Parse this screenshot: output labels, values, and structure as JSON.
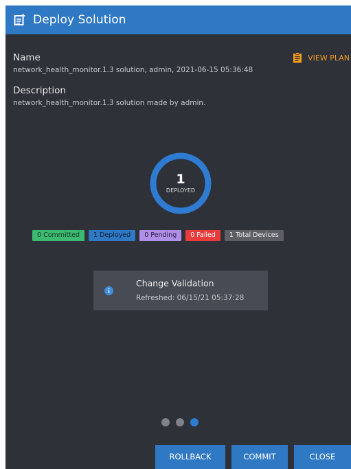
{
  "header": {
    "title": "Deploy Solution",
    "icon": "notes-add-icon"
  },
  "details": {
    "name_label": "Name",
    "name_value": "network_health_monitor.1.3 solution, admin, 2021-06-15 05:36:48",
    "description_label": "Description",
    "description_value": "network_health_monitor.1.3 solution made by admin.",
    "view_plan_label": "VIEW PLAN"
  },
  "summary": {
    "count": "1",
    "count_label": "DEPLOYED",
    "ring_color": "#2f7bd1"
  },
  "badges": [
    {
      "label": "0 Committed",
      "bg": "#3dba72",
      "fg": "#10331f"
    },
    {
      "label": "1 Deployed",
      "bg": "#2f78c4",
      "fg": "#0c1f36"
    },
    {
      "label": "0 Pending",
      "bg": "#b08fe6",
      "fg": "#2a1b47"
    },
    {
      "label": "0 Failed",
      "bg": "#ea3b3b",
      "fg": "#ffffff"
    },
    {
      "label": "1 Total Devices",
      "bg": "#5d5f64",
      "fg": "#f0f0f0"
    }
  ],
  "validation": {
    "title": "Change Validation",
    "refreshed": "Refreshed: 06/15/21 05:37:28"
  },
  "pager": {
    "total_steps": 3,
    "current_step": 3
  },
  "actions": {
    "rollback_label": "ROLLBACK",
    "commit_label": "COMMIT",
    "close_label": "CLOSE"
  }
}
